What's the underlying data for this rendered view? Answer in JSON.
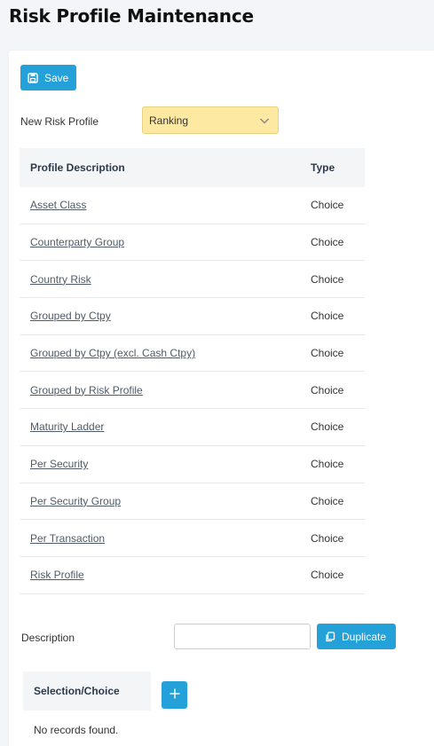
{
  "page": {
    "title": "Risk Profile Maintenance"
  },
  "toolbar": {
    "save_label": "Save"
  },
  "new_risk_profile": {
    "label": "New Risk Profile",
    "selected": "Ranking"
  },
  "profiles_table": {
    "headers": [
      "Profile Description",
      "Type"
    ],
    "rows": [
      {
        "description": "Asset Class",
        "type": "Choice"
      },
      {
        "description": "Counterparty Group",
        "type": "Choice"
      },
      {
        "description": "Country Risk",
        "type": "Choice"
      },
      {
        "description": "Grouped by Ctpy",
        "type": "Choice"
      },
      {
        "description": "Grouped by Ctpy (excl. Cash Ctpy)",
        "type": "Choice"
      },
      {
        "description": "Grouped by Risk Profile",
        "type": "Choice"
      },
      {
        "description": "Maturity Ladder",
        "type": "Choice"
      },
      {
        "description": "Per Security",
        "type": "Choice"
      },
      {
        "description": "Per Security Group",
        "type": "Choice"
      },
      {
        "description": "Per Transaction",
        "type": "Choice"
      },
      {
        "description": "Risk Profile",
        "type": "Choice"
      }
    ]
  },
  "description": {
    "label": "Description",
    "value": "",
    "duplicate_label": "Duplicate"
  },
  "selection_table": {
    "header": "Selection/Choice",
    "empty_text": "No records found."
  },
  "colors": {
    "accent": "#23a1d8",
    "select_bg": "#fde9a2",
    "header_bg": "#f4f5f7"
  },
  "icons": {
    "save": "floppy-disk-icon",
    "dropdown": "chevron-down-icon",
    "duplicate": "copy-icon",
    "add": "plus-icon"
  }
}
